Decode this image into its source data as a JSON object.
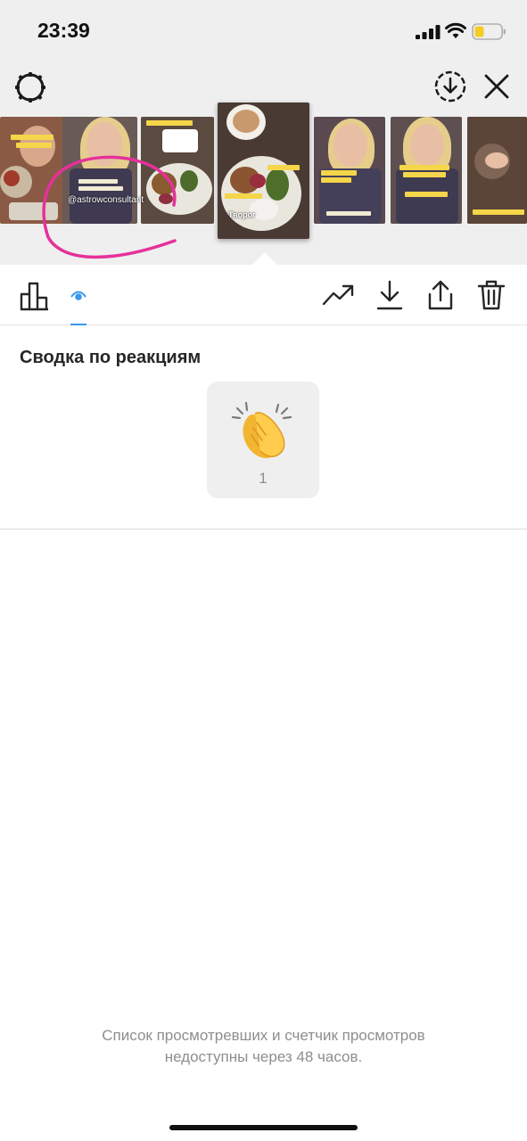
{
  "status_bar": {
    "time": "23:39"
  },
  "header": {
    "settings_icon": "gear-ring-icon",
    "download_icon": "download-circle-icon",
    "close_icon": "close-icon"
  },
  "stories": {
    "mention": "@astrowconsultant",
    "selected_sticker": "Творог"
  },
  "toolbar": {
    "items": [
      "bar-chart-icon",
      "eye-icon",
      "trending-icon",
      "download-icon",
      "share-icon",
      "trash-icon"
    ],
    "accent": "#3897f0"
  },
  "reactions": {
    "title": "Сводка по реакциям",
    "emoji": "clapping-hands-icon",
    "count": "1"
  },
  "footer": {
    "line1": "Список просмотревших и счетчик просмотров",
    "line2": "недоступны через 48 часов."
  },
  "colors": {
    "annotation": "#e5319b",
    "sticker": "#f5d54a"
  }
}
